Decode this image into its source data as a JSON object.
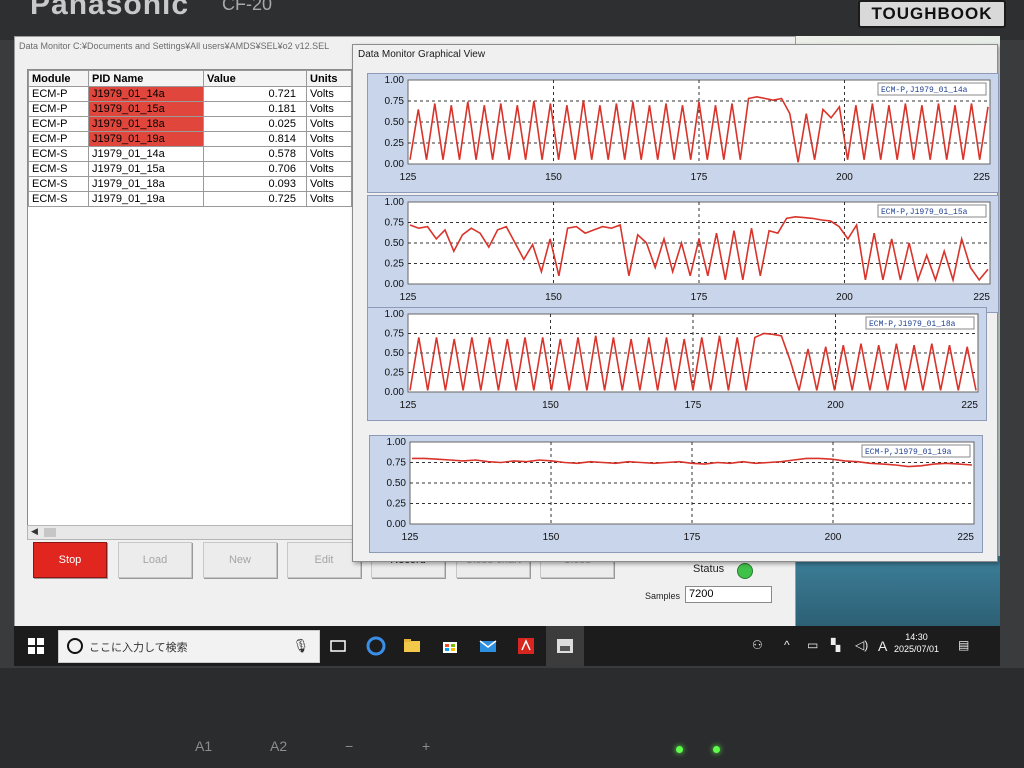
{
  "bezel": {
    "brand": "Panasonic",
    "model": "CF-20",
    "product": "TOUGHBOOK",
    "keys": [
      "A1",
      "A2",
      "−",
      "+"
    ]
  },
  "main_window": {
    "title": "Data Monitor C:¥Documents and Settings¥All users¥AMDS¥SEL¥o2 v12.SEL",
    "columns": [
      "Module",
      "PID Name",
      "Value",
      "Units"
    ],
    "rows": [
      {
        "module": "ECM-P",
        "pid": "J1979_01_14a",
        "value": "0.721",
        "units": "Volts",
        "highlight": true
      },
      {
        "module": "ECM-P",
        "pid": "J1979_01_15a",
        "value": "0.181",
        "units": "Volts",
        "highlight": true
      },
      {
        "module": "ECM-P",
        "pid": "J1979_01_18a",
        "value": "0.025",
        "units": "Volts",
        "highlight": true
      },
      {
        "module": "ECM-P",
        "pid": "J1979_01_19a",
        "value": "0.814",
        "units": "Volts",
        "highlight": true
      },
      {
        "module": "ECM-S",
        "pid": "J1979_01_14a",
        "value": "0.578",
        "units": "Volts",
        "highlight": false
      },
      {
        "module": "ECM-S",
        "pid": "J1979_01_15a",
        "value": "0.706",
        "units": "Volts",
        "highlight": false
      },
      {
        "module": "ECM-S",
        "pid": "J1979_01_18a",
        "value": "0.093",
        "units": "Volts",
        "highlight": false
      },
      {
        "module": "ECM-S",
        "pid": "J1979_01_19a",
        "value": "0.725",
        "units": "Volts",
        "highlight": false
      }
    ],
    "buttons": {
      "stop": "Stop",
      "load": "Load",
      "new": "New",
      "edit": "Edit",
      "record": "Record",
      "close_chart": "Close chart",
      "close": "Close"
    },
    "status_label": "Status",
    "status_color": "#3fc24a",
    "samples_label": "Samples",
    "samples_value": "7200"
  },
  "graph_window": {
    "title": "Data Monitor Graphical View"
  },
  "chart_data": [
    {
      "type": "line",
      "legend": "ECM-P,J1979_01_14a",
      "x_ticks": [
        125,
        150,
        175,
        200,
        225
      ],
      "y_ticks": [
        "0.00",
        "0.25",
        "0.50",
        "0.75",
        "1.00"
      ],
      "xlim": [
        125,
        225
      ],
      "ylim": [
        0,
        1
      ],
      "color": "#d9342b",
      "values": [
        0.05,
        0.65,
        0.05,
        0.72,
        0.05,
        0.7,
        0.05,
        0.74,
        0.05,
        0.7,
        0.05,
        0.72,
        0.05,
        0.7,
        0.05,
        0.75,
        0.05,
        0.72,
        0.05,
        0.7,
        0.05,
        0.76,
        0.05,
        0.7,
        0.05,
        0.72,
        0.05,
        0.74,
        0.05,
        0.7,
        0.05,
        0.72,
        0.05,
        0.7,
        0.05,
        0.74,
        0.05,
        0.7,
        0.05,
        0.72,
        0.05,
        0.78,
        0.8,
        0.78,
        0.76,
        0.78,
        0.6,
        0.02,
        0.6,
        0.05,
        0.65,
        0.55,
        0.68,
        0.05,
        0.7,
        0.05,
        0.72,
        0.05,
        0.7,
        0.05,
        0.72,
        0.05,
        0.7,
        0.05,
        0.72,
        0.05,
        0.7,
        0.05,
        0.72,
        0.05,
        0.68
      ]
    },
    {
      "type": "line",
      "legend": "ECM-P,J1979_01_15a",
      "x_ticks": [
        125,
        150,
        175,
        200,
        225
      ],
      "y_ticks": [
        "0.00",
        "0.25",
        "0.50",
        "0.75",
        "1.00"
      ],
      "xlim": [
        125,
        225
      ],
      "ylim": [
        0,
        1
      ],
      "color": "#d9342b",
      "values": [
        0.72,
        0.68,
        0.7,
        0.55,
        0.66,
        0.4,
        0.6,
        0.68,
        0.62,
        0.45,
        0.66,
        0.7,
        0.5,
        0.3,
        0.48,
        0.15,
        0.55,
        0.1,
        0.68,
        0.7,
        0.62,
        0.66,
        0.7,
        0.68,
        0.72,
        0.1,
        0.6,
        0.5,
        0.2,
        0.55,
        0.15,
        0.5,
        0.1,
        0.55,
        0.1,
        0.62,
        0.05,
        0.65,
        0.05,
        0.68,
        0.1,
        0.65,
        0.62,
        0.8,
        0.82,
        0.81,
        0.8,
        0.78,
        0.77,
        0.7,
        0.55,
        0.72,
        0.05,
        0.62,
        0.05,
        0.55,
        0.05,
        0.5,
        0.05,
        0.35,
        0.05,
        0.4,
        0.05,
        0.55,
        0.2,
        0.05,
        0.18
      ]
    },
    {
      "type": "line",
      "legend": "ECM-P,J1979_01_18a",
      "x_ticks": [
        125,
        150,
        175,
        200,
        225
      ],
      "y_ticks": [
        "0.00",
        "0.25",
        "0.50",
        "0.75",
        "1.00"
      ],
      "xlim": [
        125,
        225
      ],
      "ylim": [
        0,
        1
      ],
      "color": "#d9342b",
      "values": [
        0.02,
        0.7,
        0.02,
        0.7,
        0.02,
        0.68,
        0.02,
        0.7,
        0.02,
        0.7,
        0.02,
        0.68,
        0.02,
        0.7,
        0.02,
        0.7,
        0.02,
        0.68,
        0.02,
        0.7,
        0.02,
        0.72,
        0.02,
        0.7,
        0.02,
        0.68,
        0.02,
        0.7,
        0.02,
        0.7,
        0.02,
        0.68,
        0.02,
        0.7,
        0.02,
        0.72,
        0.02,
        0.7,
        0.02,
        0.7,
        0.75,
        0.74,
        0.72,
        0.4,
        0.02,
        0.55,
        0.02,
        0.58,
        0.02,
        0.6,
        0.02,
        0.62,
        0.02,
        0.6,
        0.02,
        0.62,
        0.02,
        0.6,
        0.02,
        0.62,
        0.02,
        0.6,
        0.02,
        0.58,
        0.02
      ]
    },
    {
      "type": "line",
      "legend": "ECM-P,J1979_01_19a",
      "x_ticks": [
        125,
        150,
        175,
        200,
        225
      ],
      "y_ticks": [
        "0.00",
        "0.25",
        "0.50",
        "0.75",
        "1.00"
      ],
      "xlim": [
        125,
        225
      ],
      "ylim": [
        0,
        1
      ],
      "color": "#d9342b",
      "values": [
        0.8,
        0.8,
        0.79,
        0.78,
        0.77,
        0.78,
        0.76,
        0.75,
        0.77,
        0.76,
        0.78,
        0.77,
        0.75,
        0.74,
        0.76,
        0.75,
        0.74,
        0.76,
        0.75,
        0.74,
        0.75,
        0.76,
        0.74,
        0.73,
        0.75,
        0.74,
        0.76,
        0.74,
        0.75,
        0.76,
        0.78,
        0.8,
        0.8,
        0.79,
        0.77,
        0.76,
        0.74,
        0.73,
        0.72,
        0.7,
        0.71,
        0.73,
        0.74,
        0.73,
        0.72
      ]
    }
  ],
  "taskbar": {
    "search_placeholder": "ここに入力して検索",
    "time": "14:30",
    "date": "2025/07/01",
    "ime": "A"
  }
}
